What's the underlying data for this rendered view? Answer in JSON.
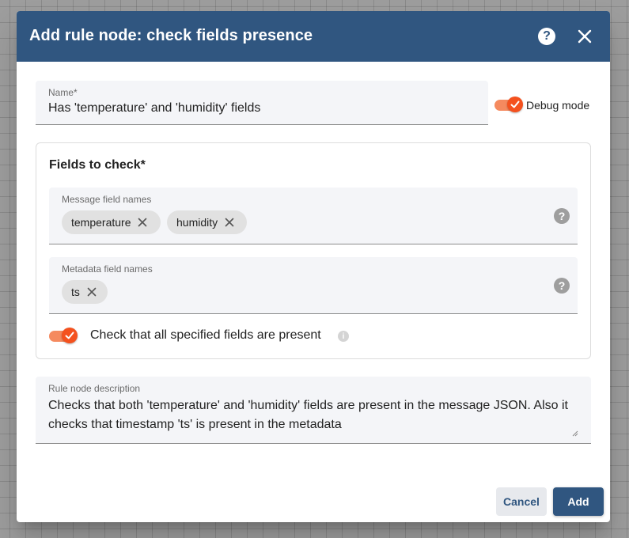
{
  "dialog": {
    "title": "Add rule node: check fields presence",
    "help_icon": "help-circle-icon",
    "close_icon": "close-icon"
  },
  "name_field": {
    "label": "Name*",
    "value": "Has 'temperature' and 'humidity' fields"
  },
  "debug_mode": {
    "label": "Debug mode",
    "enabled": true
  },
  "fields_to_check": {
    "title": "Fields to check*",
    "message_fields": {
      "label": "Message field names",
      "chips": [
        "temperature",
        "humidity"
      ],
      "help_icon": "question-circle-icon"
    },
    "metadata_fields": {
      "label": "Metadata field names",
      "chips": [
        "ts"
      ],
      "help_icon": "question-circle-icon"
    },
    "check_all": {
      "label": "Check that all specified fields are present",
      "enabled": true,
      "info_icon": "info-icon"
    }
  },
  "description": {
    "label": "Rule node description",
    "value": "Checks that both 'temperature' and 'humidity' fields are present in the message JSON. Also it checks that timestamp 'ts' is present in the metadata"
  },
  "actions": {
    "cancel_label": "Cancel",
    "add_label": "Add"
  },
  "colors": {
    "header": "#305680",
    "accent": "#f4511e",
    "toggle_track": "#f58a5f"
  }
}
